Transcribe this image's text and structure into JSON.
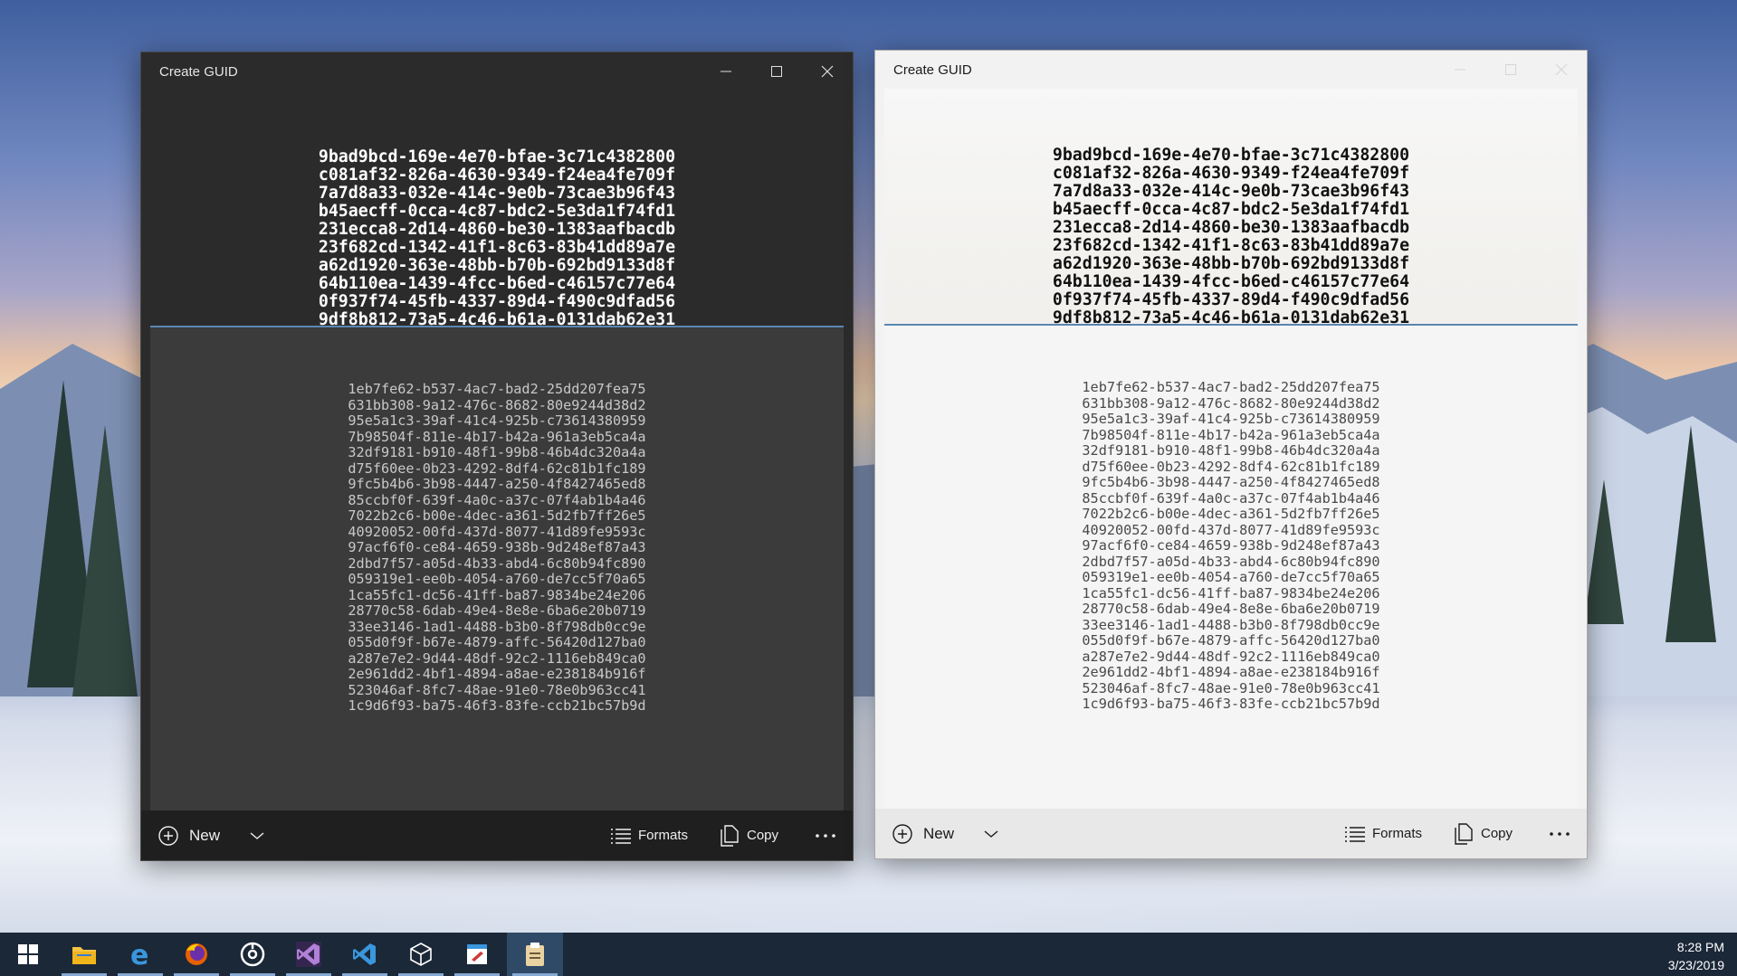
{
  "windows": {
    "dark": {
      "title": "Create GUID",
      "primary_guids": [
        "9bad9bcd-169e-4e70-bfae-3c71c4382800",
        "c081af32-826a-4630-9349-f24ea4fe709f",
        "7a7d8a33-032e-414c-9e0b-73cae3b96f43",
        "b45aecff-0cca-4c87-bdc2-5e3da1f74fd1",
        "231ecca8-2d14-4860-be30-1383aafbacdb",
        "23f682cd-1342-41f1-8c63-83b41dd89a7e",
        "a62d1920-363e-48bb-b70b-692bd9133d8f",
        "64b110ea-1439-4fcc-b6ed-c46157c77e64",
        "0f937f74-45fb-4337-89d4-f490c9dfad56",
        "9df8b812-73a5-4c46-b61a-0131dab62e31"
      ],
      "history_guids": [
        "1eb7fe62-b537-4ac7-bad2-25dd207fea75",
        "631bb308-9a12-476c-8682-80e9244d38d2",
        "95e5a1c3-39af-41c4-925b-c73614380959",
        "7b98504f-811e-4b17-b42a-961a3eb5ca4a",
        "32df9181-b910-48f1-99b8-46b4dc320a4a",
        "d75f60ee-0b23-4292-8df4-62c81b1fc189",
        "9fc5b4b6-3b98-4447-a250-4f8427465ed8",
        "85ccbf0f-639f-4a0c-a37c-07f4ab1b4a46",
        "7022b2c6-b00e-4dec-a361-5d2fb7ff26e5",
        "40920052-00fd-437d-8077-41d89fe9593c",
        "97acf6f0-ce84-4659-938b-9d248ef87a43",
        "2dbd7f57-a05d-4b33-abd4-6c80b94fc890",
        "059319e1-ee0b-4054-a760-de7cc5f70a65",
        "1ca55fc1-dc56-41ff-ba87-9834be24e206",
        "28770c58-6dab-49e4-8e8e-6ba6e20b0719",
        "33ee3146-1ad1-4488-b3b0-8f798db0cc9e",
        "055d0f9f-b67e-4879-affc-56420d127ba0",
        "a287e7e2-9d44-48df-92c2-1116eb849ca0",
        "2e961dd2-4bf1-4894-a8ae-e238184b916f",
        "523046af-8fc7-48ae-91e0-78e0b963cc41",
        "1c9d6f93-ba75-46f3-83fe-ccb21bc57b9d"
      ],
      "commands": {
        "new": "New",
        "formats": "Formats",
        "copy": "Copy"
      }
    },
    "light": {
      "title": "Create GUID",
      "primary_guids": [
        "9bad9bcd-169e-4e70-bfae-3c71c4382800",
        "c081af32-826a-4630-9349-f24ea4fe709f",
        "7a7d8a33-032e-414c-9e0b-73cae3b96f43",
        "b45aecff-0cca-4c87-bdc2-5e3da1f74fd1",
        "231ecca8-2d14-4860-be30-1383aafbacdb",
        "23f682cd-1342-41f1-8c63-83b41dd89a7e",
        "a62d1920-363e-48bb-b70b-692bd9133d8f",
        "64b110ea-1439-4fcc-b6ed-c46157c77e64",
        "0f937f74-45fb-4337-89d4-f490c9dfad56",
        "9df8b812-73a5-4c46-b61a-0131dab62e31"
      ],
      "history_guids": [
        "1eb7fe62-b537-4ac7-bad2-25dd207fea75",
        "631bb308-9a12-476c-8682-80e9244d38d2",
        "95e5a1c3-39af-41c4-925b-c73614380959",
        "7b98504f-811e-4b17-b42a-961a3eb5ca4a",
        "32df9181-b910-48f1-99b8-46b4dc320a4a",
        "d75f60ee-0b23-4292-8df4-62c81b1fc189",
        "9fc5b4b6-3b98-4447-a250-4f8427465ed8",
        "85ccbf0f-639f-4a0c-a37c-07f4ab1b4a46",
        "7022b2c6-b00e-4dec-a361-5d2fb7ff26e5",
        "40920052-00fd-437d-8077-41d89fe9593c",
        "97acf6f0-ce84-4659-938b-9d248ef87a43",
        "2dbd7f57-a05d-4b33-abd4-6c80b94fc890",
        "059319e1-ee0b-4054-a760-de7cc5f70a65",
        "1ca55fc1-dc56-41ff-ba87-9834be24e206",
        "28770c58-6dab-49e4-8e8e-6ba6e20b0719",
        "33ee3146-1ad1-4488-b3b0-8f798db0cc9e",
        "055d0f9f-b67e-4879-affc-56420d127ba0",
        "a287e7e2-9d44-48df-92c2-1116eb849ca0",
        "2e961dd2-4bf1-4894-a8ae-e238184b916f",
        "523046af-8fc7-48ae-91e0-78e0b963cc41",
        "1c9d6f93-ba75-46f3-83fe-ccb21bc57b9d"
      ],
      "commands": {
        "new": "New",
        "formats": "Formats",
        "copy": "Copy"
      }
    }
  },
  "icons": {
    "window_controls": [
      "minimize-icon",
      "maximize-icon",
      "close-icon"
    ],
    "commands": [
      "add-circle-icon",
      "chevron-down-icon",
      "list-icon",
      "copy-icon",
      "more-icon"
    ],
    "taskbar": [
      "windows-start-icon",
      "file-explorer-icon",
      "edge-icon",
      "firefox-icon",
      "groove-icon",
      "visual-studio-icon",
      "vscode-icon",
      "3d-viewer-icon",
      "paint-icon",
      "clipboard-app-icon"
    ]
  },
  "colors": {
    "accent_divider": "#5b88b3",
    "taskbar": "#1b2838"
  },
  "taskbar": {
    "time": "8:28 PM",
    "date": "3/23/2019"
  }
}
